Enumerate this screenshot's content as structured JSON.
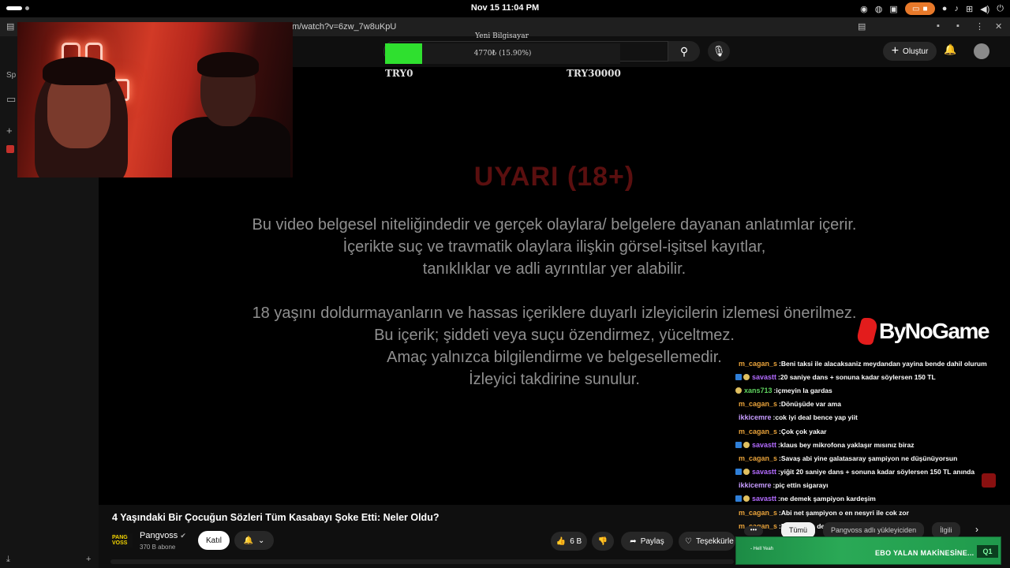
{
  "system": {
    "datetime": "Nov 15  11:04 PM"
  },
  "browser": {
    "url": "m/watch?v=6zw_7w8uKpU",
    "sidebar_label": "Sp"
  },
  "masthead": {
    "create_label": "Oluştur"
  },
  "goal": {
    "title": "Yeni Bilgisayar",
    "progress_text": "4770₺ (15.90%)",
    "progress_fraction": 0.159,
    "min_label": "TRY0",
    "max_label": "TRY30000",
    "fill_color": "#2fe02f"
  },
  "warning": {
    "title": "UYARI (18+)",
    "lines": [
      "Bu video belgesel niteliğindedir ve gerçek olaylara/ belgelere dayanan anlatımlar içerir.",
      "İçerikte suç ve travmatik olaylara ilişkin görsel-işitsel kayıtlar,",
      "tanıklıklar ve adli ayrıntılar yer alabilir.",
      "18 yaşını doldurmayanların ve hassas içeriklere duyarlı izleyicilerin izlemesi önerilmez.",
      "Bu içerik; şiddeti veya suçu özendirmez, yüceltmez.",
      "Amaç yalnızca bilgilendirme ve belgesellemedir.",
      "İzleyici takdirine sunulur."
    ]
  },
  "brand": {
    "name": "ByNoGame",
    "accent": "#e31c1c"
  },
  "chat": [
    {
      "user": "m_cagan_s",
      "color": "#e8a23a",
      "badges": false,
      "message": "Beni taksi ile alacaksaniz meydandan yayina bende dahil olurum"
    },
    {
      "user": "savastt",
      "color": "#b36bff",
      "badges": true,
      "message": "20 saniye dans + sonuna kadar söylersen 150 TL"
    },
    {
      "user": "xans713",
      "color": "#5fd35f",
      "badges": false,
      "coin": true,
      "message": "içmeyin la gardas"
    },
    {
      "user": "m_cagan_s",
      "color": "#e8a23a",
      "badges": false,
      "message": "Dönüşüde var ama"
    },
    {
      "user": "ikkicemre",
      "color": "#c79cff",
      "badges": false,
      "message": "cok iyi deal bence yap yiit"
    },
    {
      "user": "m_cagan_s",
      "color": "#e8a23a",
      "badges": false,
      "message": "Çok çok yakar"
    },
    {
      "user": "savastt",
      "color": "#b36bff",
      "badges": true,
      "message": "klaus bey mikrofona yaklaşır mısınız biraz"
    },
    {
      "user": "m_cagan_s",
      "color": "#e8a23a",
      "badges": false,
      "message": "Savaş abi yine galatasaray şampiyon ne düşünüyorsun"
    },
    {
      "user": "savastt",
      "color": "#b36bff",
      "badges": true,
      "message": "yiğit 20 saniye dans + sonuna kadar söylersen 150 TL anında"
    },
    {
      "user": "ikkicemre",
      "color": "#c79cff",
      "badges": false,
      "message": "piç ettin sigarayı"
    },
    {
      "user": "savastt",
      "color": "#b36bff",
      "badges": true,
      "message": "ne demek şampiyon kardeşim"
    },
    {
      "user": "m_cagan_s",
      "color": "#e8a23a",
      "badges": false,
      "message": "Abi net şampiyon o en nesyri ile cok zor"
    },
    {
      "user": "m_cagan_s",
      "color": "#e8a23a",
      "badges": false,
      "message": "Bak güven demir dansını izlemek isteerim"
    }
  ],
  "video": {
    "title": "4 Yaşındaki Bir Çocuğun Sözleri Tüm Kasabayı Şoke Etti: Neler Oldu?",
    "channel": "Pangvoss",
    "channel_logo_text": "PANG VOSS",
    "subscribers": "370 B abone",
    "join_label": "Katıl",
    "likes": "6 B",
    "share_label": "Paylaş",
    "thanks_label": "Teşekkürle"
  },
  "tabs": [
    "Tümü",
    "Pangvoss adlı yükleyiciden",
    "İlgili"
  ],
  "banner": {
    "text": "EBO YALAN MAKİNESİNE...",
    "sub": "- Hell Yeah",
    "count": "1"
  }
}
